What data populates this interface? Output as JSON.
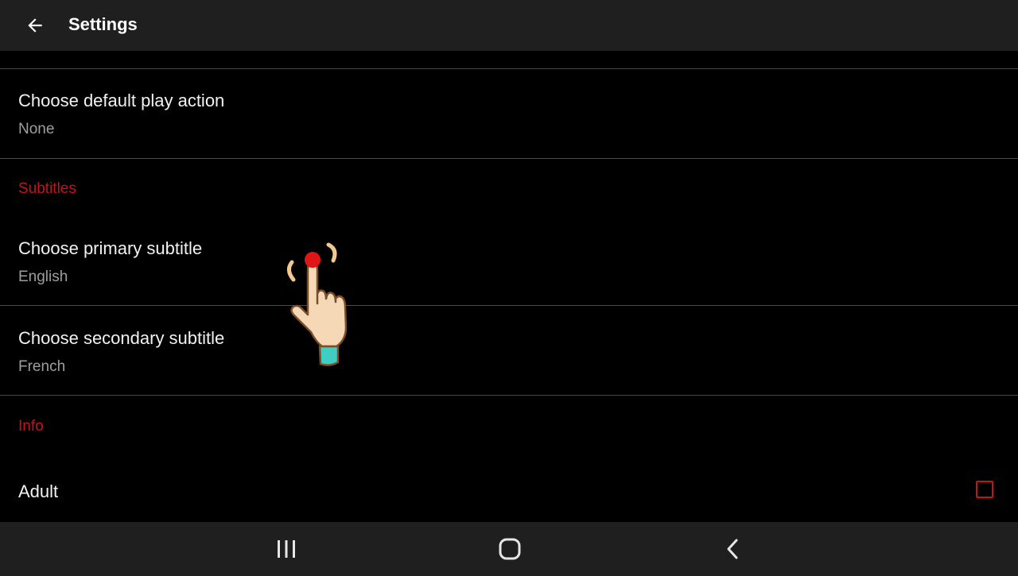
{
  "app_bar": {
    "title": "Settings",
    "back_icon": "arrow-back-icon"
  },
  "preferences": {
    "default_play_action": {
      "title": "Choose default play action",
      "summary": "None"
    },
    "subtitles_category": "Subtitles",
    "primary_subtitle": {
      "title": "Choose primary subtitle",
      "summary": "English"
    },
    "secondary_subtitle": {
      "title": "Choose secondary subtitle",
      "summary": "French"
    },
    "info_category": "Info",
    "adult": {
      "title": "Adult",
      "checked": false
    }
  },
  "colors": {
    "accent": "#c4141b",
    "bar_background": "#1f1f1f",
    "background": "#000000",
    "summary_text": "#9e9e9e"
  },
  "nav_bar": {
    "recents_icon": "recents-icon",
    "home_icon": "home-icon",
    "back_icon": "nav-back-icon"
  }
}
